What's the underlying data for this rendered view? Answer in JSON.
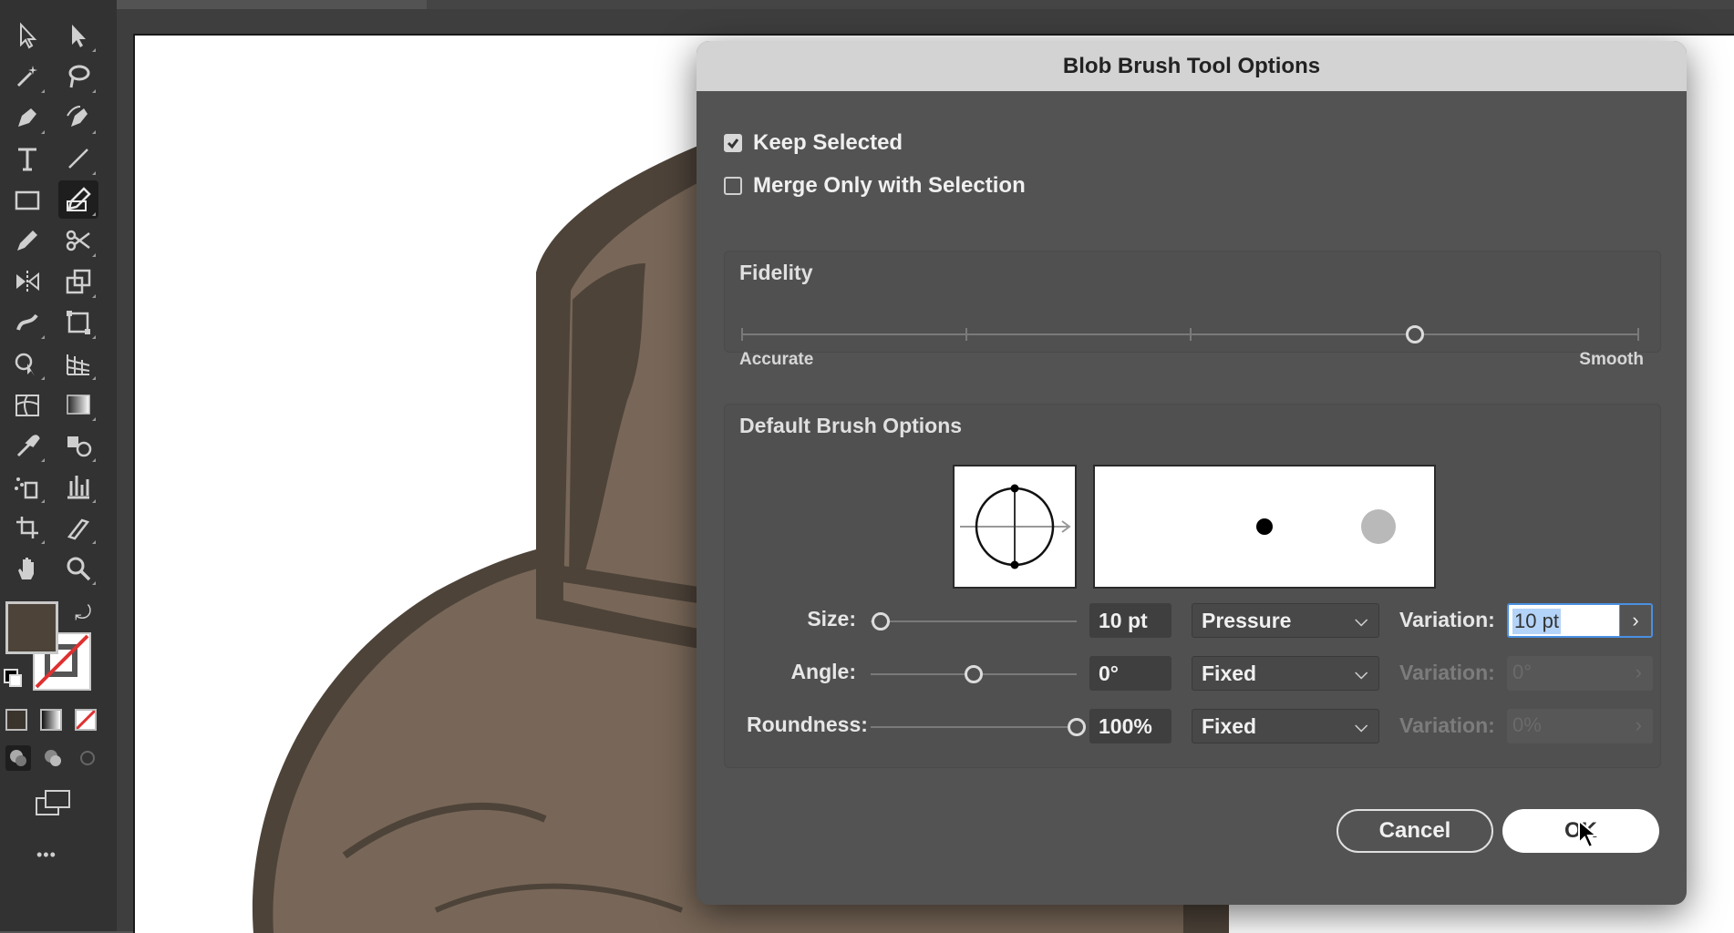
{
  "toolbar": {
    "tools": [
      {
        "name": "selection-tool-icon"
      },
      {
        "name": "direct-selection-tool-icon"
      },
      {
        "name": "magic-wand-tool-icon"
      },
      {
        "name": "lasso-tool-icon"
      },
      {
        "name": "pen-tool-icon"
      },
      {
        "name": "curvature-tool-icon"
      },
      {
        "name": "type-tool-icon"
      },
      {
        "name": "line-segment-tool-icon"
      },
      {
        "name": "rectangle-tool-icon"
      },
      {
        "name": "blob-brush-tool-icon"
      },
      {
        "name": "pencil-tool-icon"
      },
      {
        "name": "scissors-tool-icon"
      },
      {
        "name": "reflect-tool-icon"
      },
      {
        "name": "scale-tool-icon"
      },
      {
        "name": "warp-tool-icon"
      },
      {
        "name": "free-transform-tool-icon"
      },
      {
        "name": "shape-builder-tool-icon"
      },
      {
        "name": "perspective-grid-tool-icon"
      },
      {
        "name": "mesh-tool-icon"
      },
      {
        "name": "gradient-tool-icon"
      },
      {
        "name": "eyedropper-tool-icon"
      },
      {
        "name": "blend-tool-icon"
      },
      {
        "name": "symbol-sprayer-tool-icon"
      },
      {
        "name": "column-graph-tool-icon"
      },
      {
        "name": "artboard-tool-icon"
      },
      {
        "name": "slice-tool-icon"
      },
      {
        "name": "hand-tool-icon"
      },
      {
        "name": "zoom-tool-icon"
      }
    ],
    "fill_color": "#4d4339",
    "more_label": "•••"
  },
  "dialog": {
    "title": "Blob Brush Tool Options",
    "keep_selected": {
      "label": "Keep Selected",
      "checked": true
    },
    "merge_only": {
      "label": "Merge Only with Selection",
      "checked": false
    },
    "fidelity": {
      "title": "Fidelity",
      "min_label": "Accurate",
      "max_label": "Smooth",
      "value": 0.75
    },
    "brush_options": {
      "title": "Default Brush Options",
      "size": {
        "label": "Size:",
        "value": "10 pt",
        "mode": "Pressure",
        "variation_label": "Variation:",
        "variation": "10 pt",
        "slider": 0.05
      },
      "angle": {
        "label": "Angle:",
        "value": "0°",
        "mode": "Fixed",
        "variation_label": "Variation:",
        "variation": "0°",
        "slider": 0.5
      },
      "roundness": {
        "label": "Roundness:",
        "value": "100%",
        "mode": "Fixed",
        "variation_label": "Variation:",
        "variation": "0%",
        "slider": 1.0
      }
    },
    "cancel_label": "Cancel",
    "ok_label": "OK"
  }
}
